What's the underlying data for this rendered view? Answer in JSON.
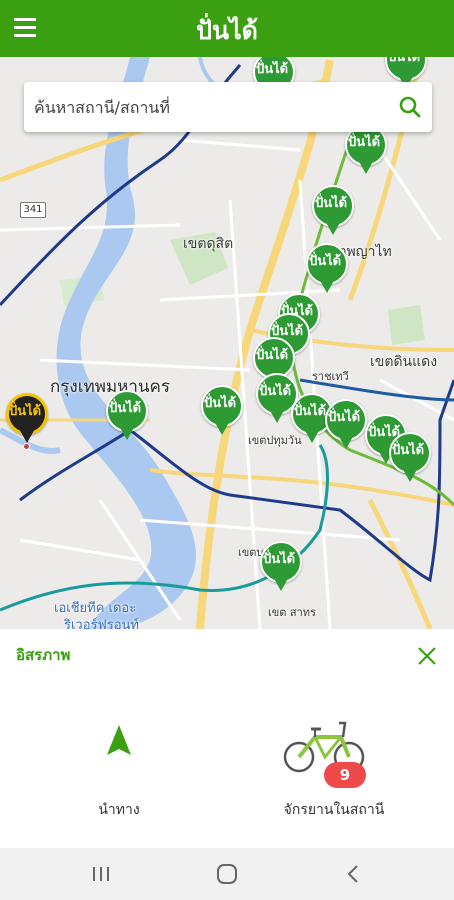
{
  "app": {
    "title": "ปั่นได้",
    "brand_color": "#3aa011"
  },
  "header": {
    "menu_icon": "hamburger-menu-icon"
  },
  "search": {
    "placeholder": "ค้นหาสถานี/สถานที่",
    "icon": "search-icon"
  },
  "map": {
    "labels": {
      "bang_khen": "เขตดุสิต",
      "phaya_thai": "เขตพญาไท",
      "din_daeng": "เขตดินแดง",
      "bangkok": "กรุงเทพมหานคร",
      "pathum_wan": "เขตปทุมวัน",
      "bang_rak": "เขตบางรัก",
      "sathon": "เขต สาทร",
      "asiatique_1": "เอเชียทีค เดอะ",
      "asiatique_2": "ริเวอร์ฟรอนท์",
      "ratchathewi": "ราชเทวี",
      "route_341": "341"
    },
    "station_pin_text": "ปั่นได้",
    "pin_color": "#2e9a34",
    "selected_pin_color": "#f5c400"
  },
  "station_panel": {
    "station_name": "อิสรภาพ",
    "close_icon": "close-icon",
    "navigate_label": "นำทาง",
    "bikes_label": "จักรยานในสถานี",
    "bikes_count": "9",
    "badge_color": "#ef4a4a"
  },
  "system_nav": {
    "recent_icon": "recent-apps-icon",
    "home_icon": "home-icon",
    "back_icon": "back-icon"
  }
}
